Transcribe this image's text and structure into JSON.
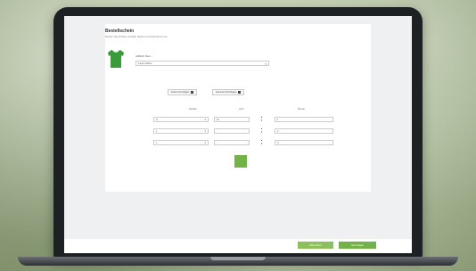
{
  "dialog": {
    "title": "Bestellschein",
    "subtitle": "Geben Sie Größe, Anzahl, Namen und Nummern an"
  },
  "product": {
    "name": "ADIDAS Trikot ...",
    "variant_placeholder": "Farbe wählen",
    "shirt_color": "#3a9b3a"
  },
  "options": [
    {
      "label": "Druck hinzufügen"
    },
    {
      "label": "Nummer hinzufügen"
    }
  ],
  "columns": {
    "size": "Größe",
    "qty": "Anz.",
    "name": "Name"
  },
  "rows": [
    {
      "size": "S",
      "qty": "10",
      "name": "1"
    },
    {
      "size": "L",
      "qty": "",
      "name": "2"
    },
    {
      "size": "L",
      "qty": "",
      "name": "3"
    }
  ],
  "footer": {
    "cancel_label": "Abbrechen",
    "add_label": "Hinzufügen"
  },
  "colors": {
    "accent": "#73b246",
    "accent_light": "#8cc05a"
  }
}
